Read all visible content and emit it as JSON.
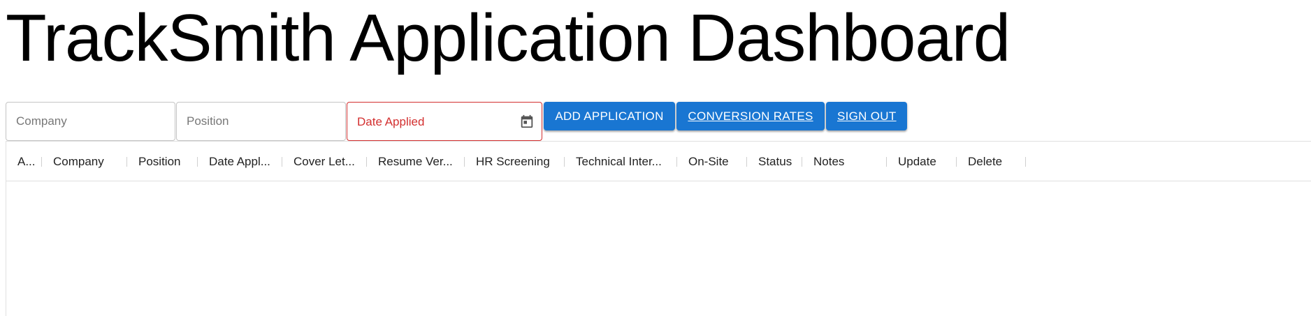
{
  "header": {
    "title": "TrackSmith Application Dashboard"
  },
  "form": {
    "company_placeholder": "Company",
    "position_placeholder": "Position",
    "date_label": "Date Applied",
    "add_button": "ADD APPLICATION",
    "conversion_button": "CONVERSION RATES",
    "signout_button": "SIGN OUT",
    "date_icon": "calendar-icon",
    "accent_color": "#1976d2",
    "error_color": "#d32f2f"
  },
  "grid": {
    "columns": [
      "A...",
      "Company",
      "Position",
      "Date Appl...",
      "Cover Let...",
      "Resume Ver...",
      "HR Screening",
      "Technical Inter...",
      "On-Site",
      "Status",
      "Notes",
      "Update",
      "Delete"
    ],
    "rows": []
  }
}
